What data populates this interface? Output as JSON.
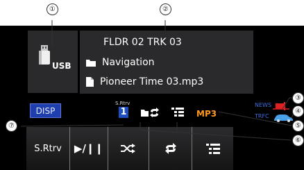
{
  "callouts": [
    "①",
    "②",
    "③",
    "④",
    "⑤",
    "⑥",
    "⑦"
  ],
  "source": {
    "label": "USB",
    "icon": "usb-drive-icon"
  },
  "track": {
    "folder_track": "FLDR 02 TRK 03",
    "folder_name": "Navigation",
    "file_name": "Pioneer Time 03.mp3"
  },
  "status": {
    "disp_label": "DISP",
    "srtrv_caption": "S.Rtrv",
    "srtrv_level": "1",
    "format": "MP3",
    "news_label": "NEWS",
    "trfc_label": "TRFC"
  },
  "bottom_bar": {
    "srtrv_label": "S.Rtrv",
    "play_pause_label": "▶/❙❙"
  },
  "colors": {
    "background": "#000000",
    "panel": "#2a2a2c",
    "disp_button": "#1f3fae",
    "format_text": "#ff9a1f",
    "news_trfc_text": "#3f6ee0"
  }
}
